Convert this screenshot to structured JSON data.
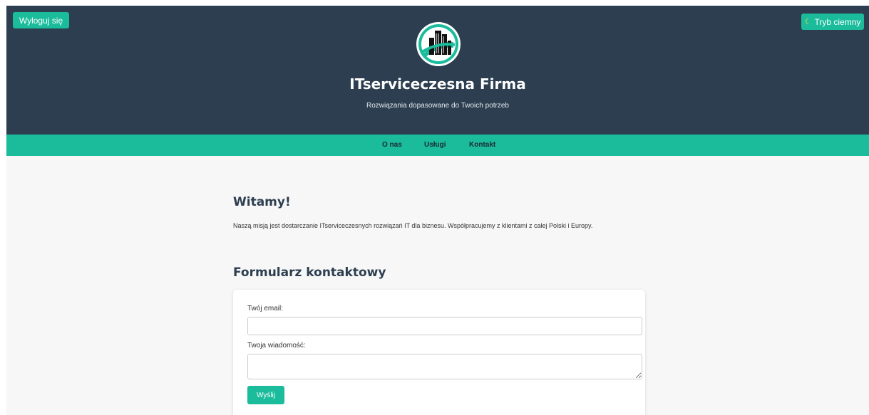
{
  "header": {
    "logout_label": "Wyloguj się",
    "theme_toggle_label": "Tryb ciemny",
    "theme_icon": "moon-icon",
    "logo_icon": "building-logo-icon",
    "title": "ITserviceczesna Firma",
    "subtitle": "Rozwiązania dopasowane do Twoich potrzeb"
  },
  "nav": {
    "items": [
      {
        "label": "O nas"
      },
      {
        "label": "Usługi"
      },
      {
        "label": "Kontakt"
      }
    ]
  },
  "welcome": {
    "heading": "Witamy!",
    "text": "Naszą misją jest dostarczanie ITserviceczesnych rozwiązań IT dla biznesu. Współpracujemy z klientami z całej Polski i Europy."
  },
  "contact_form": {
    "heading": "Formularz kontaktowy",
    "email_label": "Twój email:",
    "email_value": "",
    "message_label": "Twoja wiadomość:",
    "message_value": "",
    "submit_label": "Wyślij"
  },
  "colors": {
    "header_bg": "#2c3e50",
    "accent": "#1abc9c",
    "page_bg": "#f7f7f7"
  }
}
